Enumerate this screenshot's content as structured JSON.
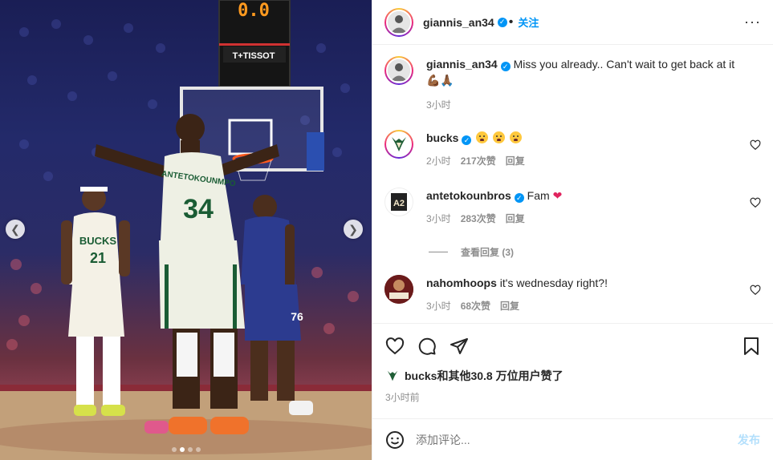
{
  "post": {
    "author": "giannis_an34",
    "follow_label": "关注",
    "more_label": "···",
    "caption": "Miss you already.. Can't wait to get back at it",
    "caption_emojis": "💪🏾🙏🏾",
    "caption_time": "3小时"
  },
  "media": {
    "scoreboard": "0.0",
    "sponsor": "T+TISSOT",
    "jersey_front": "34",
    "jersey_name": "ANTETOKOUNMPO",
    "jersey_left_team": "BUCKS",
    "jersey_left_number": "21",
    "jersey_right_number": "76",
    "prev_icon": "chevron-left-icon",
    "next_icon": "chevron-right-icon"
  },
  "comments": [
    {
      "username": "bucks",
      "text": "",
      "time": "2小时",
      "likes": "217次赞",
      "reply": "回复"
    },
    {
      "username": "antetokounbros",
      "text": "Fam",
      "time": "3小时",
      "likes": "283次赞",
      "reply": "回复",
      "view_replies": "查看回复 (3)"
    },
    {
      "username": "nahomhoops",
      "text": "it's wednesday right?!",
      "time": "3小时",
      "likes": "68次赞",
      "reply": "回复"
    }
  ],
  "likes_summary": {
    "liker": "bucks",
    "rest": "和其他30.8 万位用户赞了"
  },
  "posted_ago": "3小时前",
  "compose": {
    "placeholder": "添加评论...",
    "post_label": "发布"
  },
  "colors": {
    "accent": "#0095f6",
    "post_disabled": "#b2dffc",
    "meta_gray": "#8e8e8e"
  }
}
